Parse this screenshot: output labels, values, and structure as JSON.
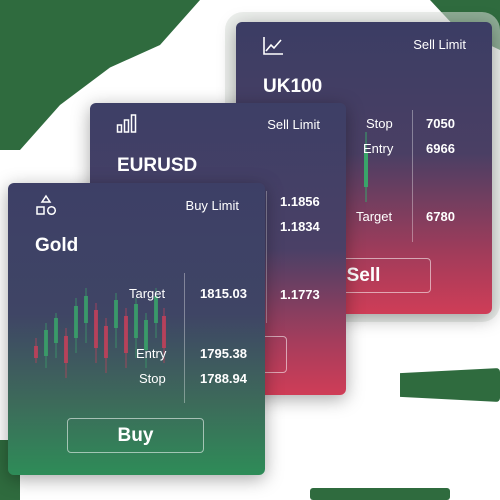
{
  "cards": {
    "uk100": {
      "symbol": "UK100",
      "order_type": "Sell Limit",
      "stop_label": "Stop",
      "stop_value": "7050",
      "entry_label": "Entry",
      "entry_value": "6966",
      "target_label": "Target",
      "target_value": "6780",
      "action_label": "Sell",
      "icon": "line-chart-icon"
    },
    "eurusd": {
      "symbol": "EURUSD",
      "order_type": "Sell Limit",
      "stop_value": "1.1856",
      "entry_value": "1.1834",
      "target_value": "1.1773",
      "icon": "bar-chart-icon"
    },
    "gold": {
      "symbol": "Gold",
      "order_type": "Buy Limit",
      "target_label": "Target",
      "target_value": "1815.03",
      "entry_label": "Entry",
      "entry_value": "1795.38",
      "stop_label": "Stop",
      "stop_value": "1788.94",
      "action_label": "Buy",
      "icon": "shapes-icon"
    }
  },
  "colors": {
    "sell": "#cf3d57",
    "buy": "#2e8c58",
    "card_top": "#3d3f66",
    "deco_green": "#2f6b3e"
  }
}
